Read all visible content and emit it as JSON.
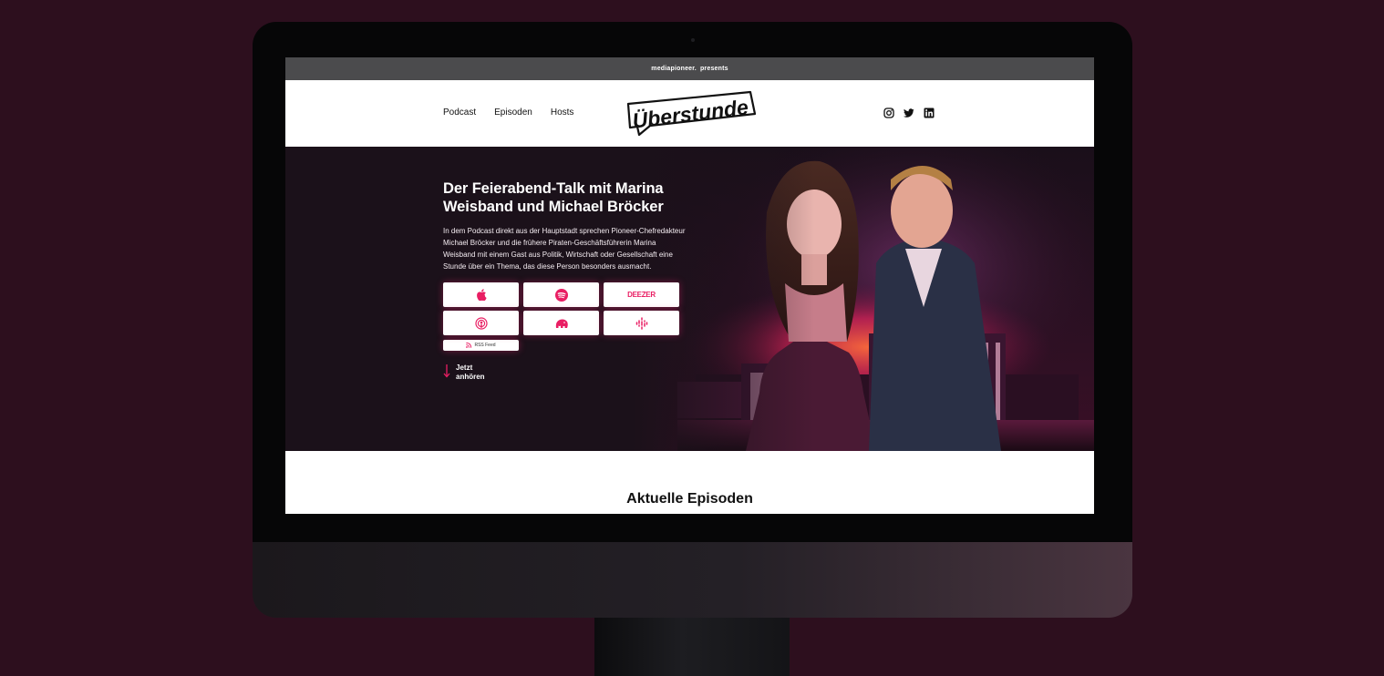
{
  "topbar": {
    "brand": "mediapioneer.",
    "presents": "presents"
  },
  "nav": {
    "links": [
      "Podcast",
      "Episoden",
      "Hosts"
    ],
    "logo_text": "Überstunde",
    "social_icons": [
      "instagram-icon",
      "twitter-icon",
      "linkedin-icon"
    ]
  },
  "hero": {
    "title": "Der Feierabend-Talk mit Marina Weisband und Michael Bröcker",
    "text": "In dem Podcast direkt aus der Hauptstadt sprechen Pioneer-Chefredakteur Michael Bröcker und die frühere Piraten-Geschäftsführerin Marina Weisband mit einem Gast aus Politik, Wirtschaft oder Gesellschaft eine Stunde über ein Thema, das diese Person besonders ausmacht.",
    "platforms": [
      {
        "name": "apple-podcasts-icon"
      },
      {
        "name": "spotify-icon"
      },
      {
        "name": "deezer-logo",
        "label": "DEEZER"
      },
      {
        "name": "podcast-app-icon"
      },
      {
        "name": "elephant-podcast-icon"
      },
      {
        "name": "google-podcasts-icon"
      }
    ],
    "rss_label": "RSS Feed",
    "listen_label": "Jetzt anhören"
  },
  "episodes": {
    "title": "Aktuelle Episoden"
  },
  "colors": {
    "accent": "#e91e63",
    "page_background": "#2d0f1e",
    "topbar": "#4b4b4d",
    "hero_dark": "#1b111a"
  }
}
